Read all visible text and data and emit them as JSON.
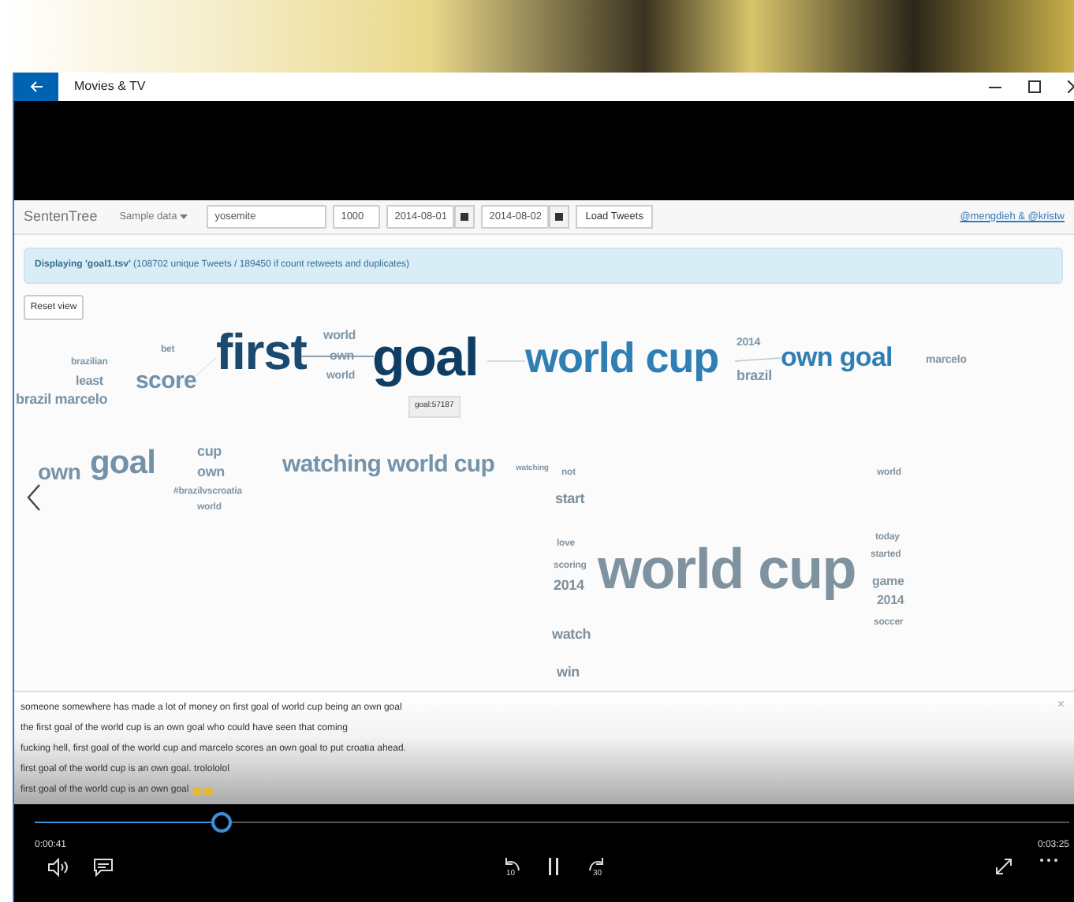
{
  "window": {
    "title": "Movies & TV"
  },
  "app": {
    "brand": "SentenTree",
    "sample_menu": "Sample data",
    "query": "yosemite",
    "count": "1000",
    "start_date": "2014-08-01",
    "end_date": "2014-08-02",
    "load_button": "Load Tweets",
    "credits": "@mengdieh & @kristw",
    "alert": "**Displaying 'goal1.tsv'** (108702 unique Tweets / 189450 if count retweets and duplicates)",
    "reset_button": "Reset view",
    "words": [
      {
        "text": "first",
        "color": "#1b4a70"
      },
      {
        "text": "goal",
        "color": "#0f3d63"
      },
      {
        "text": "world cup",
        "color": "#2f7fb5"
      },
      {
        "text": "own goal",
        "color": "#2f7fb5"
      },
      {
        "text": "score",
        "color": "#6f93ae"
      },
      {
        "text": "bet",
        "color": "#7d96a9"
      },
      {
        "text": "brazilian",
        "color": "#7d96a9"
      },
      {
        "text": "least",
        "color": "#7892a6"
      },
      {
        "text": "brazil marcelo",
        "color": "#7892a6"
      },
      {
        "text": "world",
        "color": "#7d96a9"
      },
      {
        "text": "own",
        "color": "#7d96a9"
      },
      {
        "text": "world",
        "color": "#7d96a9"
      },
      {
        "text": "2014",
        "color": "#7d96a9"
      },
      {
        "text": "brazil",
        "color": "#7d96a9"
      },
      {
        "text": "marcelo",
        "color": "#8297a8"
      },
      {
        "text": "own",
        "color": "#7892a6"
      },
      {
        "text": "goal",
        "color": "#7292aa"
      },
      {
        "text": "cup",
        "color": "#7d96a9"
      },
      {
        "text": "own",
        "color": "#7d96a9"
      },
      {
        "text": "#brazilvscroatia",
        "color": "#8297a8"
      },
      {
        "text": "world",
        "color": "#8297a8"
      },
      {
        "text": "watching world cup",
        "color": "#7494ac"
      },
      {
        "text": "watching",
        "color": "#8297a8"
      },
      {
        "text": "not",
        "color": "#84949f"
      },
      {
        "text": "world",
        "color": "#84949f"
      },
      {
        "text": "start",
        "color": "#7f8f9b"
      },
      {
        "text": "world cup",
        "color": "#7f929f"
      },
      {
        "text": "today",
        "color": "#84949f"
      },
      {
        "text": "love",
        "color": "#84949f"
      },
      {
        "text": "started",
        "color": "#84949f"
      },
      {
        "text": "scoring",
        "color": "#84949f"
      },
      {
        "text": "2014",
        "color": "#7f8f9b"
      },
      {
        "text": "game",
        "color": "#84949f"
      },
      {
        "text": "2014",
        "color": "#84949f"
      },
      {
        "text": "soccer",
        "color": "#84949f"
      },
      {
        "text": "watch",
        "color": "#7f8f9b"
      },
      {
        "text": "win",
        "color": "#7f8f9b"
      }
    ],
    "tooltip": "goal:57187",
    "tweets_close": "×",
    "tweets": [
      {
        "text": "someone somewhere has made a lot of money on first goal of world cup being an own goal",
        "has_emoji": false
      },
      {
        "text": "the first goal of the world cup is an own goal who could have seen that coming",
        "has_emoji": false
      },
      {
        "text": "fucking hell, first goal of the world cup and marcelo scores an own goal to put croatia ahead.",
        "has_emoji": false
      },
      {
        "text": "first goal of the world cup is an own goal. trolololol",
        "has_emoji": false
      },
      {
        "text": "first goal of the world cup is an own goal",
        "has_emoji": true
      }
    ]
  },
  "player": {
    "elapsed": "0:00:41",
    "total": "0:03:25",
    "level": 0.18,
    "skip_back": "10",
    "skip_forward": "30"
  }
}
